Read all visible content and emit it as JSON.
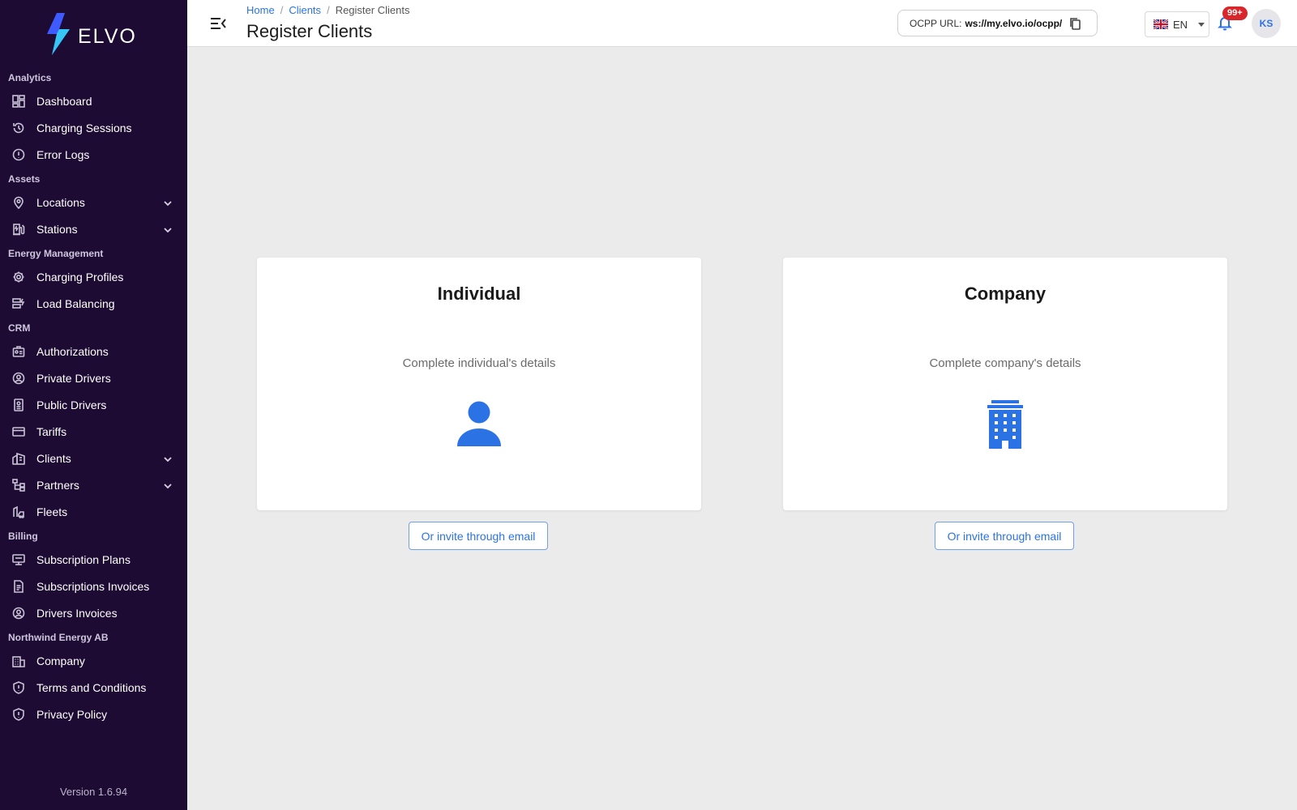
{
  "app": {
    "logo_text": "ELVO",
    "version": "Version 1.6.94"
  },
  "sidebar": {
    "sections": [
      {
        "title": "Analytics",
        "items": [
          {
            "label": "Dashboard",
            "icon": "dashboard-icon"
          },
          {
            "label": "Charging Sessions",
            "icon": "history-icon"
          },
          {
            "label": "Error Logs",
            "icon": "alert-circle-icon"
          }
        ]
      },
      {
        "title": "Assets",
        "items": [
          {
            "label": "Locations",
            "icon": "map-pin-icon",
            "expandable": true
          },
          {
            "label": "Stations",
            "icon": "charging-station-icon",
            "expandable": true
          }
        ]
      },
      {
        "title": "Energy Management",
        "items": [
          {
            "label": "Charging Profiles",
            "icon": "settings-gear-icon"
          },
          {
            "label": "Load Balancing",
            "icon": "load-balancing-icon"
          }
        ]
      },
      {
        "title": "CRM",
        "items": [
          {
            "label": "Authorizations",
            "icon": "id-badge-icon"
          },
          {
            "label": "Private Drivers",
            "icon": "user-circle-icon"
          },
          {
            "label": "Public Drivers",
            "icon": "id-card-icon"
          },
          {
            "label": "Tariffs",
            "icon": "credit-card-icon"
          },
          {
            "label": "Clients",
            "icon": "building-icon",
            "expandable": true
          },
          {
            "label": "Partners",
            "icon": "hierarchy-icon",
            "expandable": true
          },
          {
            "label": "Fleets",
            "icon": "fleet-icon"
          }
        ]
      },
      {
        "title": "Billing",
        "items": [
          {
            "label": "Subscription Plans",
            "icon": "plan-icon"
          },
          {
            "label": "Subscriptions Invoices",
            "icon": "invoice-icon"
          },
          {
            "label": "Drivers Invoices",
            "icon": "user-circle-icon"
          }
        ]
      },
      {
        "title": "Northwind Energy AB",
        "items": [
          {
            "label": "Company",
            "icon": "company-icon"
          },
          {
            "label": "Terms and Conditions",
            "icon": "shield-icon"
          },
          {
            "label": "Privacy Policy",
            "icon": "shield-icon"
          }
        ]
      }
    ]
  },
  "header": {
    "breadcrumb": {
      "home": "Home",
      "clients": "Clients",
      "current": "Register Clients"
    },
    "title": "Register Clients",
    "ocpp": {
      "label": "OCPP URL:",
      "value": "ws://my.elvo.io/ocpp/"
    },
    "language": "EN",
    "notifications_badge": "99+",
    "avatar_initials": "KS"
  },
  "cards": {
    "individual": {
      "title": "Individual",
      "subtitle": "Complete individual's details",
      "invite_label": "Or invite through email"
    },
    "company": {
      "title": "Company",
      "subtitle": "Complete company's details",
      "invite_label": "Or invite through email"
    }
  },
  "colors": {
    "sidebar_bg": "#1d0b34",
    "accent": "#2b73e5",
    "badge": "#d9262b",
    "background": "#ebebeb"
  }
}
